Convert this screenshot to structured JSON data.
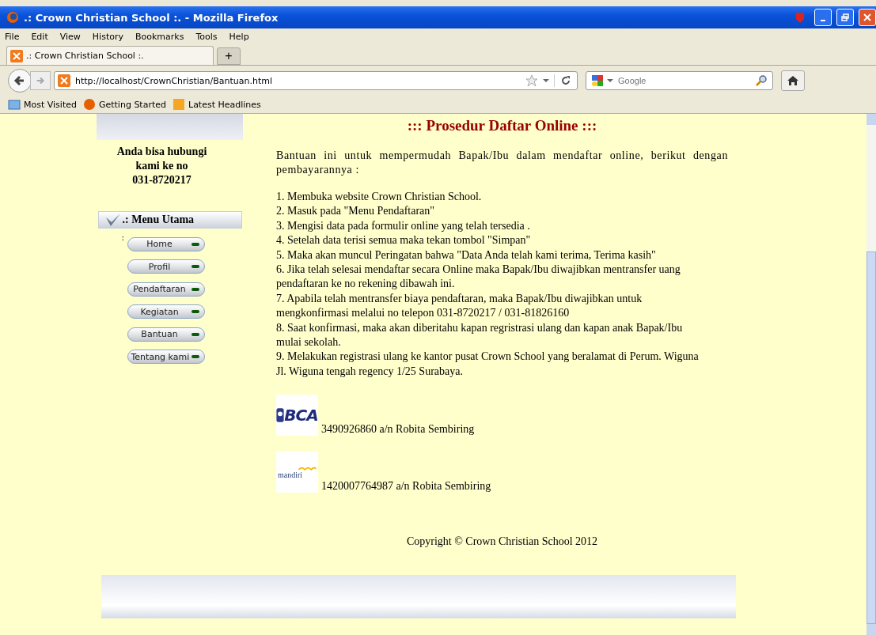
{
  "window": {
    "title": ".: Crown Christian School :. - Mozilla Firefox"
  },
  "menu": [
    "File",
    "Edit",
    "View",
    "History",
    "Bookmarks",
    "Tools",
    "Help"
  ],
  "tabs": [
    {
      "label": ".: Crown Christian School :.",
      "selected": true
    }
  ],
  "new_tab": "+",
  "address_bar": {
    "url": "http://localhost/CrownChristian/Bantuan.html"
  },
  "search": {
    "placeholder": "Google"
  },
  "bookmarks": [
    "Most Visited",
    "Getting Started",
    "Latest Headlines"
  ],
  "sidebar": {
    "contact_lines": [
      "Anda bisa hubungi",
      "kami ke no",
      "031-8720217"
    ],
    "menu_title": ".: Menu Utama",
    "menu_marker": ":",
    "menu_items": [
      "Home",
      "Profil",
      "Pendaftaran",
      "Kegiatan",
      "Bantuan",
      "Tentang kami"
    ]
  },
  "main": {
    "heading": "::: Prosedur Daftar Online :::",
    "intro": "Bantuan ini untuk mempermudah Bapak/Ibu dalam mendaftar online, berikut dengan pembayarannya :",
    "steps": [
      "1. Membuka website Crown Christian School.",
      "2. Masuk pada \"Menu Pendaftaran\"",
      "3. Mengisi data pada formulir online yang telah tersedia .",
      "4. Setelah data terisi semua maka tekan tombol \"Simpan\"",
      "5. Maka akan muncul Peringatan bahwa \"Data Anda telah kami terima, Terima kasih\"",
      "6. Jika telah selesai mendaftar secara Online maka Bapak/Ibu diwajibkan mentransfer uang pendaftaran ke no rekening dibawah ini.",
      "7. Apabila telah mentransfer biaya pendaftaran, maka Bapak/Ibu diwajibkan untuk mengkonfirmasi melalui no telepon 031-8720217 / 031-81826160",
      "8. Saat konfirmasi, maka akan diberitahu kapan regristrasi ulang dan kapan anak Bapak/Ibu mulai sekolah.",
      "9. Melakukan registrasi ulang ke kantor pusat Crown School yang beralamat di Perum. Wiguna Jl. Wiguna tengah regency 1/25 Surabaya."
    ],
    "banks": [
      {
        "kind": "bca",
        "logo_text": "BCA",
        "account": "3490926860 a/n Robita Sembiring"
      },
      {
        "kind": "mandiri",
        "logo_text": "mandiri",
        "account": "1420007764987 a/n Robita Sembiring"
      }
    ],
    "copyright": "Copyright © Crown Christian School 2012"
  }
}
